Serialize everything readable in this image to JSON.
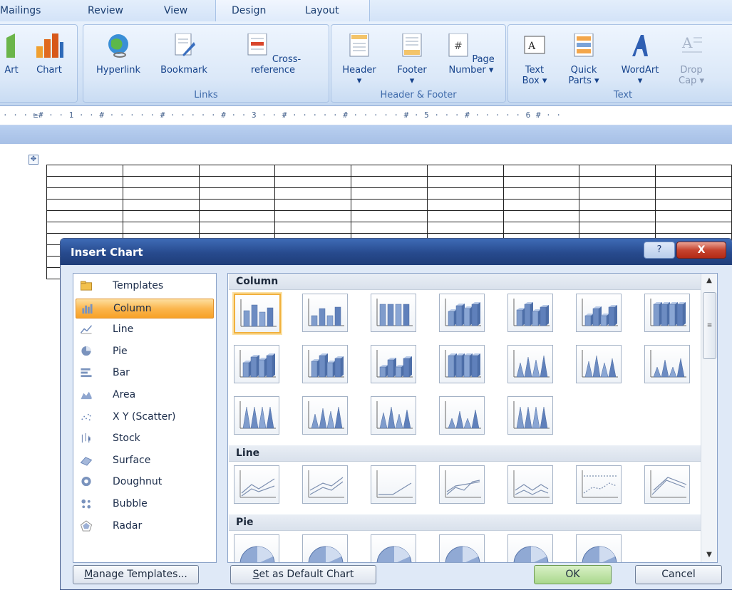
{
  "tabs": [
    "Mailings",
    "Review",
    "View",
    "Design",
    "Layout"
  ],
  "ribbon": {
    "art_partial": "Art",
    "chart": "Chart",
    "links_group": {
      "label": "Links",
      "buttons": [
        "Hyperlink",
        "Bookmark",
        "Cross-reference"
      ]
    },
    "header_footer_group": {
      "label": "Header & Footer",
      "buttons": [
        {
          "line1": "Header",
          "line2": "▾"
        },
        {
          "line1": "Footer",
          "line2": "▾"
        },
        {
          "line1": "Page",
          "line2": "Number ▾"
        }
      ]
    },
    "text_group": {
      "label": "Text",
      "buttons": [
        {
          "line1": "Text",
          "line2": "Box ▾"
        },
        {
          "line1": "Quick",
          "line2": "Parts ▾"
        },
        {
          "line1": "WordArt",
          "line2": "▾"
        },
        {
          "line1": "Drop",
          "line2": "Cap ▾"
        }
      ]
    }
  },
  "ruler": {
    "text": "· · · ⊵# · · 1 · ·  #  · · · · · # · · · · · # · · 3 · · # · · · · · # · · · · · # · 5 · · ·  #  · · · · · 6 # · ·"
  },
  "dialog": {
    "title": "Insert Chart",
    "help": "?",
    "close": "X",
    "chart_types": [
      {
        "label": "Templates",
        "icon": "folder-icon"
      },
      {
        "label": "Column",
        "icon": "column-chart-icon"
      },
      {
        "label": "Line",
        "icon": "line-chart-icon"
      },
      {
        "label": "Pie",
        "icon": "pie-chart-icon"
      },
      {
        "label": "Bar",
        "icon": "bar-chart-icon"
      },
      {
        "label": "Area",
        "icon": "area-chart-icon"
      },
      {
        "label": "X Y (Scatter)",
        "icon": "scatter-chart-icon"
      },
      {
        "label": "Stock",
        "icon": "stock-chart-icon"
      },
      {
        "label": "Surface",
        "icon": "surface-chart-icon"
      },
      {
        "label": "Doughnut",
        "icon": "doughnut-chart-icon"
      },
      {
        "label": "Bubble",
        "icon": "bubble-chart-icon"
      },
      {
        "label": "Radar",
        "icon": "radar-chart-icon"
      }
    ],
    "selected_type": "Column",
    "sections": {
      "column": "Column",
      "line": "Line",
      "pie": "Pie"
    },
    "buttons": {
      "manage_templates": "Manage Templates...",
      "set_default": "Set as Default Chart",
      "ok": "OK",
      "cancel": "Cancel"
    }
  },
  "colors": {
    "accent_selected": "#f7a127",
    "title_bar": "#274a8d",
    "ribbon_text": "#15428b"
  }
}
